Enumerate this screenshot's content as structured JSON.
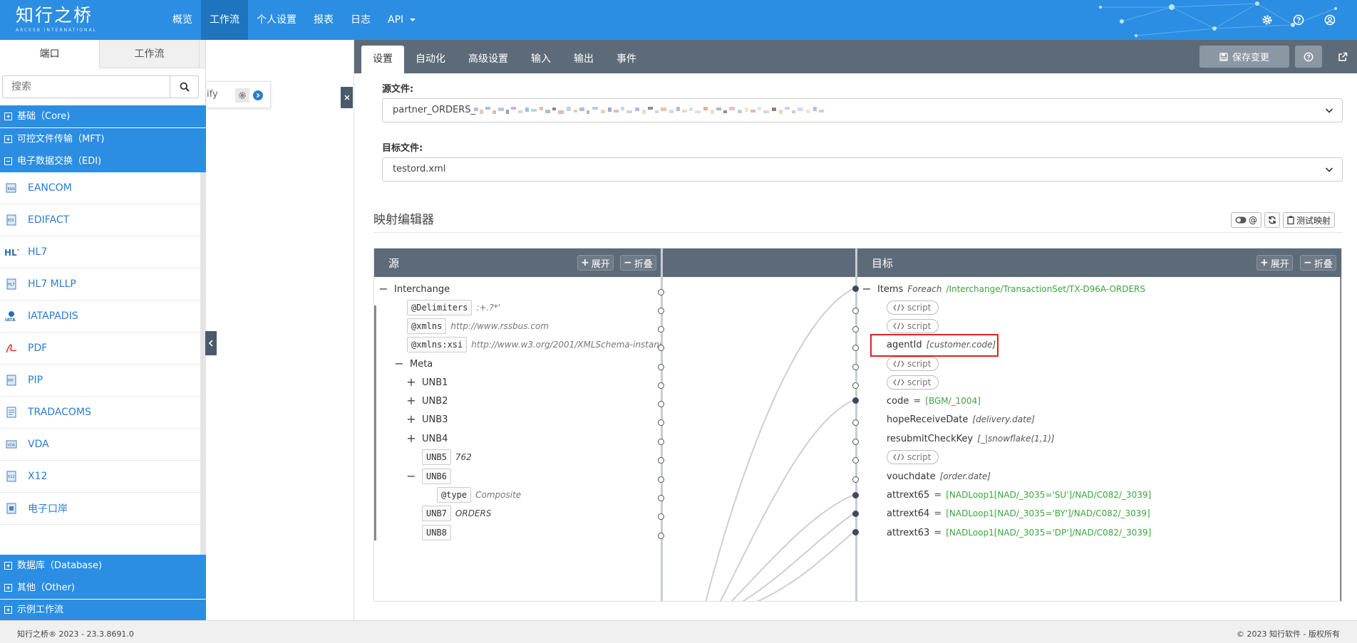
{
  "app": {
    "logo_text": "知行之桥",
    "logo_sub": "ARCESB INTERNATIONAL"
  },
  "nav": {
    "items": [
      {
        "label": "概览"
      },
      {
        "label": "工作流",
        "active": true
      },
      {
        "label": "个人设置"
      },
      {
        "label": "报表"
      },
      {
        "label": "日志"
      },
      {
        "label": "API"
      }
    ],
    "icons": [
      "gear-icon",
      "help-icon",
      "user-icon"
    ]
  },
  "sidebar": {
    "tabs": [
      {
        "label": "端口",
        "active": true
      },
      {
        "label": "工作流"
      }
    ],
    "search_placeholder": "搜索",
    "categories_top": [
      {
        "label": "基础（Core)",
        "expanded": false
      },
      {
        "label": "可控文件传输（MFT)",
        "expanded": false
      },
      {
        "label": "电子数据交换（EDI)",
        "expanded": true
      }
    ],
    "edi_items": [
      {
        "label": "EANCOM"
      },
      {
        "label": "EDIFACT"
      },
      {
        "label": "HL7"
      },
      {
        "label": "HL7 MLLP"
      },
      {
        "label": "IATAPADIS"
      },
      {
        "label": "PDF"
      },
      {
        "label": "PIP"
      },
      {
        "label": "TRADACOMS"
      },
      {
        "label": "VDA"
      },
      {
        "label": "X12"
      },
      {
        "label": "电子口岸"
      }
    ],
    "categories_bottom": [
      {
        "label": "数据库（Database)"
      },
      {
        "label": "其他（Other)"
      },
      {
        "label": "示例工作流"
      }
    ]
  },
  "canvas": {
    "node_text": "ify"
  },
  "panel": {
    "tabs": [
      {
        "label": "设置",
        "active": true
      },
      {
        "label": "自动化"
      },
      {
        "label": "高级设置"
      },
      {
        "label": "输入"
      },
      {
        "label": "输出"
      },
      {
        "label": "事件"
      }
    ],
    "save_label": "保存变更",
    "source_label": "源文件:",
    "source_value": "partner_ORDERS_",
    "target_label": "目标文件:",
    "target_value": "testord.xml",
    "mapper_title": "映射编辑器",
    "test_label": "测试映射",
    "toggle_label": "@"
  },
  "mapper": {
    "source_title": "源",
    "target_title": "目标",
    "expand_label": "展开",
    "collapse_label": "折叠",
    "source_rows": [
      {
        "kind": "node",
        "toggle": "−",
        "name": "Interchange"
      },
      {
        "kind": "attr",
        "tag": "@Delimiters",
        "value": ":+.?*'"
      },
      {
        "kind": "attr",
        "tag": "@xmlns",
        "value": "http://www.rssbus.com"
      },
      {
        "kind": "attr",
        "tag": "@xmlns:xsi",
        "value": "http://www.w3.org/2001/XMLSchema-instance"
      },
      {
        "kind": "node",
        "toggle": "−",
        "name": "Meta"
      },
      {
        "kind": "node",
        "toggle": "+",
        "name": "UNB1"
      },
      {
        "kind": "node",
        "toggle": "+",
        "name": "UNB2"
      },
      {
        "kind": "node",
        "toggle": "+",
        "name": "UNB3"
      },
      {
        "kind": "node",
        "toggle": "+",
        "name": "UNB4"
      },
      {
        "kind": "leaf",
        "tag": "UNB5",
        "value": "762"
      },
      {
        "kind": "leaf",
        "toggle": "−",
        "tag": "UNB6",
        "value": ""
      },
      {
        "kind": "attr",
        "tag": "@type",
        "value": "Composite"
      },
      {
        "kind": "leaf",
        "tag": "UNB7",
        "value": "ORDERS"
      },
      {
        "kind": "leaf",
        "tag": "UNB8",
        "value": ""
      }
    ],
    "target_rows": [
      {
        "kind": "foreach",
        "toggle": "−",
        "name": "Items",
        "keyword": "Foreach",
        "expr": "/Interchange/TransactionSet/TX-D96A-ORDERS"
      },
      {
        "kind": "script",
        "label": "script"
      },
      {
        "kind": "script",
        "label": "script"
      },
      {
        "kind": "field",
        "name": "agentId",
        "value": "[customer.code]",
        "highlight": true
      },
      {
        "kind": "script",
        "label": "script"
      },
      {
        "kind": "script",
        "label": "script"
      },
      {
        "kind": "assign",
        "name": "code",
        "expr": "[BGM/_1004]"
      },
      {
        "kind": "field",
        "name": "hopeReceiveDate",
        "value": "[delivery.date]"
      },
      {
        "kind": "field",
        "name": "resubmitCheckKey",
        "value": "[_|snowflake(1,1)]"
      },
      {
        "kind": "script",
        "label": "script"
      },
      {
        "kind": "field",
        "name": "vouchdate",
        "value": "[order.date]"
      },
      {
        "kind": "assign",
        "name": "attrext65",
        "expr": "[NADLoop1[NAD/_3035='SU']/NAD/C082/_3039]"
      },
      {
        "kind": "assign",
        "name": "attrext64",
        "expr": "[NADLoop1[NAD/_3035='BY']/NAD/C082/_3039]"
      },
      {
        "kind": "assign",
        "name": "attrext63",
        "expr": "[NADLoop1[NAD/_3035='DP']/NAD/C082/_3039]"
      }
    ]
  },
  "footer": {
    "left": "知行之桥® 2023 - 23.3.8691.0",
    "right": "© 2023 知行软件 - 版权所有"
  },
  "colors": {
    "primary": "#2b8ee2",
    "nav_active": "#1f74bf",
    "panel_bar": "#5d6b78",
    "link": "#2b7bd0",
    "expr_green": "#3aa63a",
    "highlight": "#e02020"
  }
}
